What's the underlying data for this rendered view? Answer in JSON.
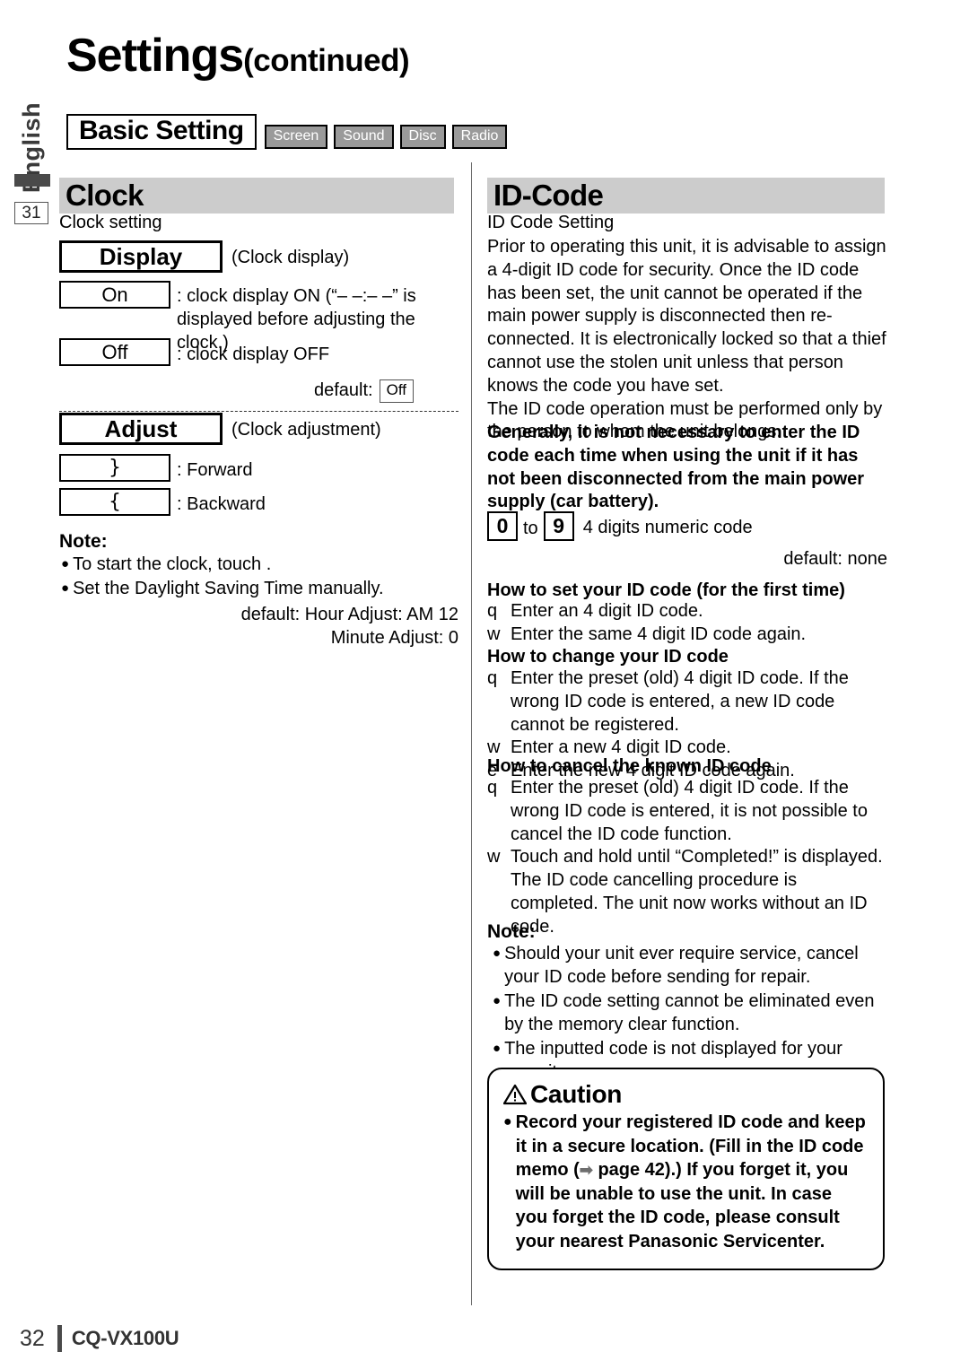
{
  "language_tab": "English",
  "page_marker": "31",
  "title": {
    "main": "Settings",
    "continued": "(continued)"
  },
  "setting_bar": {
    "name": "Basic Setting",
    "tabs": [
      "Screen",
      "Sound",
      "Disc",
      "Radio"
    ]
  },
  "left_column": {
    "section": {
      "heading": "Clock",
      "subtitle": "Clock setting"
    },
    "display": {
      "label": "Display",
      "caption": "(Clock display)",
      "options": [
        {
          "box": "On",
          "text": ": clock display ON (“– –:– –” is displayed before adjusting the clock.)"
        },
        {
          "box": "Off",
          "text": ": clock display OFF"
        }
      ],
      "default_label": "default:",
      "default_value": "Off"
    },
    "adjust": {
      "label": "Adjust",
      "caption": "(Clock adjustment)",
      "options": [
        {
          "box": "}",
          "text": ": Forward"
        },
        {
          "box": "{",
          "text": ": Backward"
        }
      ]
    },
    "note": {
      "title": "Note:",
      "items": [
        "To start the clock, touch          .",
        "Set the Daylight Saving Time manually."
      ]
    },
    "defaults": [
      "default: Hour Adjust: AM 12",
      "Minute Adjust: 0"
    ]
  },
  "right_column": {
    "section": {
      "heading": "ID-Code",
      "subtitle": "ID Code Setting"
    },
    "intro": "Prior to operating this unit, it is advisable to assign a 4-digit ID code for security. Once the ID code has been set, the unit cannot be operated if the main power supply is disconnected then re-connected. It is electronically locked so that a thief cannot use the stolen unit unless that person knows the code you have set.\nThe ID code operation must be performed only by the person to whom the unit belongs.",
    "bold_notice": "Generally, it is not necessary to enter the ID code each time when using the unit if it has not been disconnected from the main power supply (car battery).",
    "digits": {
      "from": "0",
      "to_label": "to",
      "to": "9",
      "description": "4 digits numeric code"
    },
    "default_none": "default: none",
    "procedures": [
      {
        "heading": "How to set your ID code (for the first time)",
        "steps": [
          {
            "num": "q",
            "text": "Enter an 4 digit ID code."
          },
          {
            "num": "w",
            "text": "Enter the same 4 digit ID code again."
          }
        ]
      },
      {
        "heading": "How to change your ID code",
        "steps": [
          {
            "num": "q",
            "text": "Enter the preset (old) 4 digit ID code. If the wrong ID code is entered, a new ID code cannot be registered."
          },
          {
            "num": "w",
            "text": "Enter a new 4 digit ID code."
          },
          {
            "num": "e",
            "text": "Enter the new 4 digit ID code again."
          }
        ]
      },
      {
        "heading": "How to cancel the known ID code",
        "steps": [
          {
            "num": "q",
            "text": "Enter the preset (old) 4 digit ID code. If the wrong ID code is entered, it is not possible to cancel the ID code function."
          },
          {
            "num": "w",
            "text": "Touch and hold          until “Completed!” is displayed. The ID code cancelling procedure is completed. The unit now works without an ID code."
          }
        ]
      }
    ],
    "note": {
      "title": "Note:",
      "items": [
        "Should your unit ever require service, cancel your ID code before sending for repair.",
        "The ID code setting cannot be eliminated even by the memory clear function.",
        "The inputted code is not displayed for your security."
      ]
    },
    "caution": {
      "heading": "Caution",
      "body_part1": "Record your registered ID code and keep it in a secure location. (Fill in the ID code memo (",
      "arrow": "➡",
      "body_part2": " page 42).) If you forget it, you will be unable to use the unit. In case you forget the ID code, please consult your nearest Panasonic Servicenter."
    }
  },
  "footer": {
    "page": "32",
    "model": "CQ-VX100U"
  }
}
